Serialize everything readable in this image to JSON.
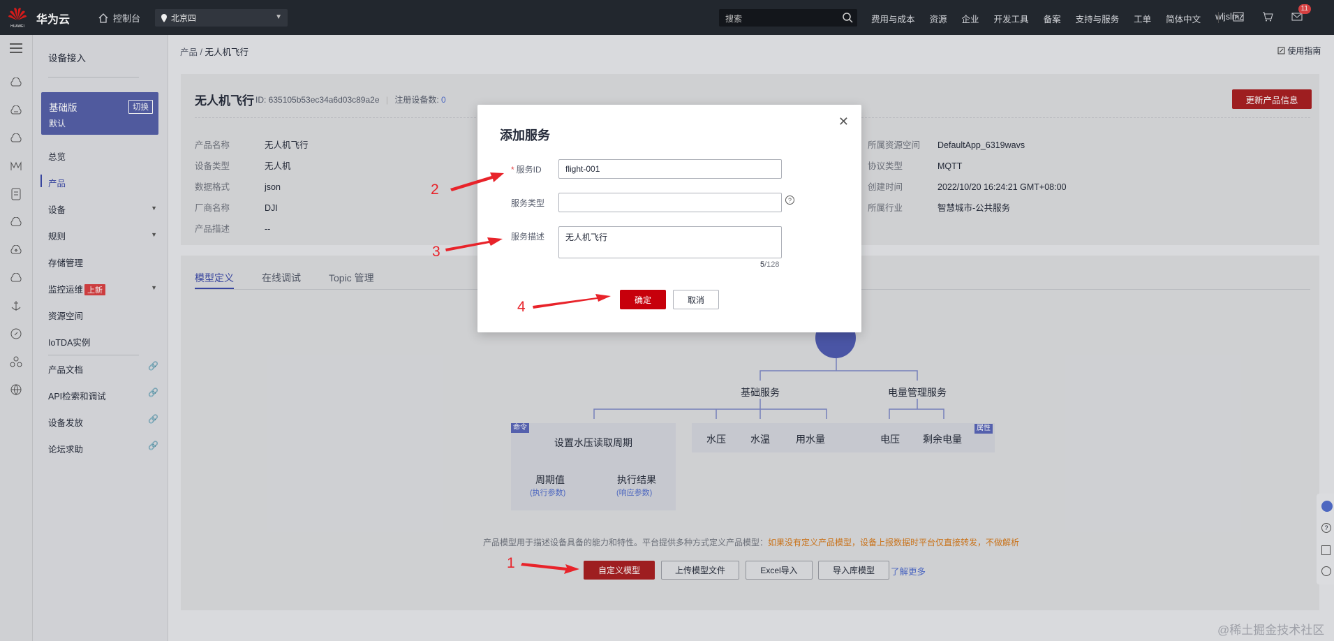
{
  "topbar": {
    "brand": "华为云",
    "console": "控制台",
    "region": "北京四",
    "search_placeholder": "搜索",
    "nav": [
      "费用与成本",
      "资源",
      "企业",
      "开发工具",
      "备案",
      "支持与服务",
      "工单",
      "简体中文",
      "wljslmz"
    ],
    "mail_badge": "11"
  },
  "sidebar": {
    "title": "设备接入",
    "edition": "基础版",
    "edition_sub": "默认",
    "switch": "切换",
    "items": [
      {
        "label": "总览"
      },
      {
        "label": "产品"
      },
      {
        "label": "设备"
      },
      {
        "label": "规则"
      },
      {
        "label": "存储管理"
      },
      {
        "label": "监控运维"
      },
      {
        "label": "资源空间"
      },
      {
        "label": "IoTDA实例"
      },
      {
        "label": "产品文档"
      },
      {
        "label": "API检索和调试"
      },
      {
        "label": "设备发放"
      },
      {
        "label": "论坛求助"
      }
    ],
    "new_tag": "上新"
  },
  "breadcrumb": {
    "root": "产品",
    "sep": "/",
    "current": "无人机飞行"
  },
  "guide": "使用指南",
  "product": {
    "name": "无人机飞行",
    "id_text": "ID: 635105b53ec34a6d03c89a2e",
    "reg_label": "注册设备数:",
    "reg_count": "0",
    "update_btn": "更新产品信息",
    "left": [
      {
        "k": "产品名称",
        "v": "无人机飞行"
      },
      {
        "k": "设备类型",
        "v": "无人机"
      },
      {
        "k": "数据格式",
        "v": "json"
      },
      {
        "k": "厂商名称",
        "v": "DJI"
      },
      {
        "k": "产品描述",
        "v": "--"
      }
    ],
    "right": [
      {
        "k": "所属资源空间",
        "v": "DefaultApp_6319wavs"
      },
      {
        "k": "协议类型",
        "v": "MQTT"
      },
      {
        "k": "创建时间",
        "v": "2022/10/20 16:24:21 GMT+08:00"
      },
      {
        "k": "所属行业",
        "v": "智慧城市-公共服务"
      }
    ]
  },
  "tabs": [
    "模型定义",
    "在线调试",
    "Topic 管理"
  ],
  "diagram": {
    "svc1": "基础服务",
    "svc2": "电量管理服务",
    "cmd_tag": "命令",
    "prop_tag": "属性",
    "cmd_name": "设置水压读取周期",
    "cmd_param": "周期值",
    "cmd_param_sub": "(执行参数)",
    "cmd_result": "执行结果",
    "cmd_result_sub": "(响应参数)",
    "props": [
      "水压",
      "水温",
      "用水量",
      "电压",
      "剩余电量"
    ]
  },
  "model_desc": "产品模型用于描述设备具备的能力和特性。平台提供多种方式定义产品模型：",
  "model_warn": "如果没有定义产品模型，设备上报数据时平台仅直接转发，不做解析",
  "buttons": {
    "custom": "自定义模型",
    "upload": "上传模型文件",
    "excel": "Excel导入",
    "lib": "导入库模型",
    "learn": "了解更多"
  },
  "modal": {
    "title": "添加服务",
    "service_id_label": "服务ID",
    "service_id_value": "flight-001",
    "service_type_label": "服务类型",
    "service_type_value": "",
    "service_desc_label": "服务描述",
    "service_desc_value": "无人机飞行",
    "counter_current": "5",
    "counter_max": "/128",
    "ok": "确定",
    "cancel": "取消"
  },
  "annotations": [
    "1",
    "2",
    "3",
    "4"
  ],
  "watermark": "@稀土掘金技术社区",
  "colors": {
    "accent": "#3c4aa8",
    "brand_red": "#c7000b",
    "annotation": "#e8232a"
  }
}
